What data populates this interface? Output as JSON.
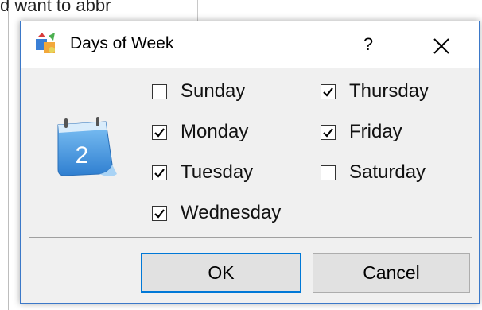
{
  "background": {
    "text_fragment": "d want to abbr"
  },
  "dialog": {
    "title": "Days of Week",
    "help_label": "?",
    "close_label": "✕"
  },
  "days": [
    {
      "label": "Sunday",
      "checked": false
    },
    {
      "label": "Monday",
      "checked": true
    },
    {
      "label": "Tuesday",
      "checked": true
    },
    {
      "label": "Wednesday",
      "checked": true
    },
    {
      "label": "Thursday",
      "checked": true
    },
    {
      "label": "Friday",
      "checked": true
    },
    {
      "label": "Saturday",
      "checked": false
    }
  ],
  "calendar_icon": {
    "number": "2"
  },
  "buttons": {
    "ok": "OK",
    "cancel": "Cancel"
  },
  "colors": {
    "accent": "#0078d7",
    "dialog_bg": "#f0f0f0",
    "calendar_blue": "#3b8ad8"
  },
  "icons": [
    "app-icon",
    "calendar-icon",
    "help-icon",
    "close-icon",
    "checkmark-icon"
  ]
}
